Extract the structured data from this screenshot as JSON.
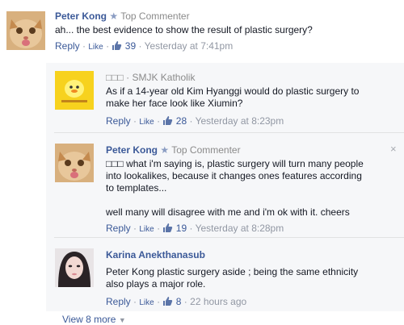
{
  "comments": [
    {
      "author": "Peter Kong",
      "badge": "Top Commenter",
      "text": "ah... the best evidence to show the result of plastic surgery?",
      "reply": "Reply",
      "like": "Like",
      "likes": "39",
      "time": "Yesterday at 7:41pm"
    }
  ],
  "replies": [
    {
      "author": "□□□",
      "badge": "SMJK Katholik",
      "text_lines": [
        "As if a 14-year old Kim Hyanggi would do plastic surgery to",
        "make her face look like Xiumin?"
      ],
      "reply": "Reply",
      "like": "Like",
      "likes": "28",
      "time": "Yesterday at 8:23pm"
    },
    {
      "author": "Peter Kong",
      "badge": "Top Commenter",
      "text_lines": [
        "□□□ what i'm saying is, plastic surgery will turn many people",
        "into lookalikes, because it changes ones features according",
        "to templates..."
      ],
      "text2": "well many will disagree with me and i'm ok with it. cheers",
      "reply": "Reply",
      "like": "Like",
      "likes": "19",
      "time": "Yesterday at 8:28pm",
      "close": "×"
    },
    {
      "author": "Karina Anekthanasub",
      "text_lines": [
        "Peter Kong plastic surgery aside ; being the same ethnicity",
        "also plays a major role."
      ],
      "reply": "Reply",
      "like": "Like",
      "likes": "8",
      "time": "22 hours ago"
    }
  ],
  "view_more": "View 8 more",
  "view_more_icon": "chevron-down-icon",
  "colors": {
    "link": "#3b5998",
    "meta": "#9197a3",
    "reply_bg": "#f6f7f9",
    "divider": "#e1e2e3"
  }
}
